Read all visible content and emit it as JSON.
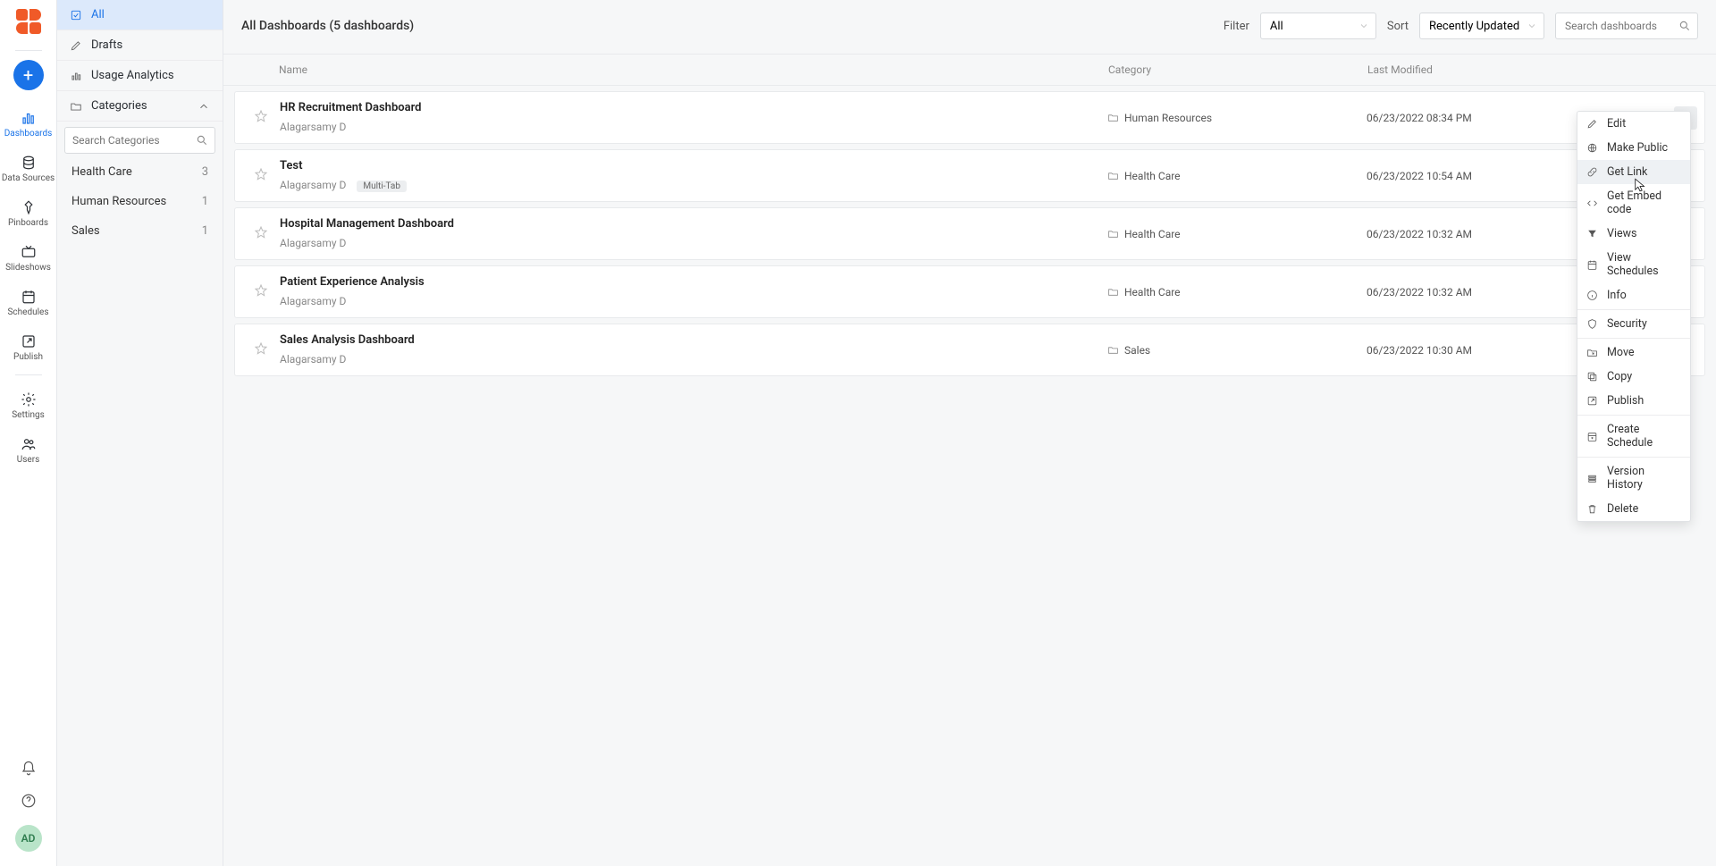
{
  "rail": {
    "items": [
      {
        "label": "Dashboards"
      },
      {
        "label": "Data Sources"
      },
      {
        "label": "Pinboards"
      },
      {
        "label": "Slideshows"
      },
      {
        "label": "Schedules"
      },
      {
        "label": "Publish"
      },
      {
        "label": "Settings"
      },
      {
        "label": "Users"
      }
    ]
  },
  "avatar_initials": "AD",
  "sidebar": {
    "all": "All",
    "drafts": "Drafts",
    "usage": "Usage Analytics",
    "categories_label": "Categories",
    "search_placeholder": "Search Categories",
    "categories": [
      {
        "name": "Health Care",
        "count": "3"
      },
      {
        "name": "Human Resources",
        "count": "1"
      },
      {
        "name": "Sales",
        "count": "1"
      }
    ]
  },
  "page_title": "All Dashboards (5 dashboards)",
  "filter_label": "Filter",
  "filter_value": "All",
  "sort_label": "Sort",
  "sort_value": "Recently Updated",
  "search_placeholder": "Search dashboards",
  "columns": {
    "name": "Name",
    "category": "Category",
    "modified": "Last Modified"
  },
  "rows": [
    {
      "title": "HR Recruitment Dashboard",
      "author": "Alagarsamy D",
      "category": "Human Resources",
      "modified": "06/23/2022 08:34 PM",
      "tag": ""
    },
    {
      "title": "Test",
      "author": "Alagarsamy D",
      "category": "Health Care",
      "modified": "06/23/2022 10:54 AM",
      "tag": "Multi-Tab"
    },
    {
      "title": "Hospital Management Dashboard",
      "author": "Alagarsamy D",
      "category": "Health Care",
      "modified": "06/23/2022 10:32 AM",
      "tag": ""
    },
    {
      "title": "Patient Experience Analysis",
      "author": "Alagarsamy D",
      "category": "Health Care",
      "modified": "06/23/2022 10:32 AM",
      "tag": ""
    },
    {
      "title": "Sales Analysis Dashboard",
      "author": "Alagarsamy D",
      "category": "Sales",
      "modified": "06/23/2022 10:30 AM",
      "tag": ""
    }
  ],
  "menu": [
    {
      "label": "Edit",
      "icon": "pencil"
    },
    {
      "label": "Make Public",
      "icon": "globe"
    },
    {
      "label": "Get Link",
      "icon": "link",
      "hover": true
    },
    {
      "label": "Get Embed code",
      "icon": "code"
    },
    {
      "label": "Views",
      "icon": "filter"
    },
    {
      "label": "View Schedules",
      "icon": "calendar"
    },
    {
      "label": "Info",
      "icon": "info"
    },
    {
      "label": "Security",
      "icon": "shield",
      "divider_before": true
    },
    {
      "label": "Move",
      "icon": "move",
      "divider_before": true
    },
    {
      "label": "Copy",
      "icon": "copy"
    },
    {
      "label": "Publish",
      "icon": "publish"
    },
    {
      "label": "Create Schedule",
      "icon": "schedule",
      "divider_before": true
    },
    {
      "label": "Version History",
      "icon": "history",
      "divider_before": true
    },
    {
      "label": "Delete",
      "icon": "trash"
    }
  ]
}
